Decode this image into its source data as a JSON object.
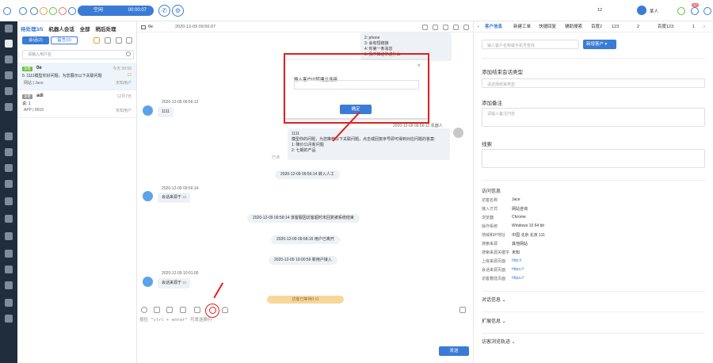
{
  "topbar": {
    "status": "空闲",
    "timer": "00:00:07",
    "user_id": "12",
    "user_name": "某人",
    "badge": "47"
  },
  "list": {
    "tabs": [
      "待处理3/5",
      "机器人会话",
      "全部",
      "稍后处理"
    ],
    "pills": [
      "会话(2)",
      "留言(0)"
    ],
    "search_placeholder": "请输入用户名",
    "items": [
      {
        "tag": "访客",
        "name": "0e",
        "time": "今天 09:56",
        "msg": "5: 1111模型你好问题，为您展示以下关联问题",
        "source": "网站 | Jace",
        "state": "未知用户",
        "count": "12"
      },
      {
        "tag": "访客",
        "name": "adi",
        "time": "12月7日",
        "msg": "说: 1",
        "source": "APP | 8910",
        "state": "未知用户",
        "count": ""
      }
    ]
  },
  "chat": {
    "header_id": "0e",
    "header_time": "2020-12-09 09:56:07",
    "top_bubble": [
      "2: phone",
      "3: 会有短链接",
      "4: 你第一条消息",
      "5: 我不知道你说什么"
    ],
    "msg1_time": "2020-12-09 09:56:12",
    "msg1": "1111",
    "robot_time": "2020-12-09 09:56:12 机器人",
    "robot_text": [
      "1111",
      "模型你的问题，为您推荐以下关联问题，点击或回复序号即可得到对应问题的答案:",
      "1: 降价11月新问题",
      "2: 七期的产品"
    ],
    "read_mark": "已读",
    "sys1": "2020-12-09 09:56:14 转入人工",
    "msg2_time": "2020-12-09 09:56:14",
    "msg2": "会话来源于",
    "sys2": "2020-12-09 09:58:14 该客服因访客超时未回复被系统结束",
    "sys3": "2020-12-09 09:58:15 用户已离开",
    "sys4": "2020-12-09 10:00:59 新用户接入",
    "msg3_time": "2020-12-09 10:01:00",
    "msg3": "会话来源于",
    "wait": "访客已等待0:11",
    "input_placeholder": "按住 \"ctrl + enter\" 可发送换行",
    "send": "发送"
  },
  "modal": {
    "label": "输入客户ID转建立连接",
    "ok": "确定",
    "close": "×"
  },
  "info": {
    "tabs": [
      "客户信息",
      "新建工单",
      "快捷回复",
      "辅助搜索",
      "百度2",
      "123",
      "2",
      "百度123",
      "1"
    ],
    "customer_placeholder": "输入客户名称或手机号查找",
    "new_customer": "新增客户",
    "session_type_title": "添加结束会话类型",
    "session_type_placeholder": "请选择结束类型",
    "remark_title": "添加备注",
    "remark_placeholder": "请输入备注内容",
    "clue_title": "线索",
    "visit_title": "访问信息",
    "visit": [
      [
        "访客名称",
        "Jace"
      ],
      [
        "接入方式",
        "网站咨询"
      ],
      [
        "浏览器",
        "Chrome"
      ],
      [
        "操作系统",
        "Windows 10 64 bit"
      ],
      [
        "地域和IP地址",
        "中国 北京 北京 111"
      ],
      [
        "搜索来源",
        "其他网站"
      ],
      [
        "搜索来源关键字",
        "未知"
      ],
      [
        "上级来源页面",
        "http://"
      ],
      [
        "会话来源页面",
        "https://"
      ],
      [
        "访客着陆页面",
        "https://"
      ]
    ],
    "sections": [
      "对话信息",
      "扩展信息",
      "访客浏览轨迹"
    ]
  },
  "colors": {
    "accent": "#3a7bd5",
    "sidebar": "#1f2d3d",
    "highlight": "#e02020"
  }
}
